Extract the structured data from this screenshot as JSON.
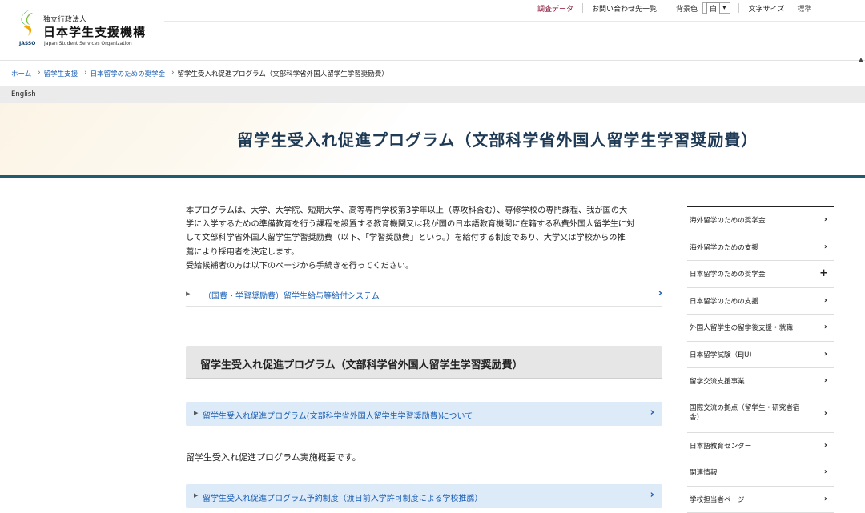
{
  "header": {
    "logo_small": "独立行政法人",
    "logo_big": "日本学生支援機構",
    "logo_jasso": "JASSO",
    "logo_english": "Japan Student Services Organization",
    "util_links": [
      "調査データ",
      "お問い合わせ先一覧"
    ],
    "bg_color_label": "背景色",
    "bg_color_value": "白",
    "bg_color_caret": "▾",
    "font_size_label": "文字サイズ",
    "font_size_value": "標準"
  },
  "breadcrumb": {
    "items": [
      "ホーム",
      "留学生支援",
      "日本留学のための奨学金",
      "留学生受入れ促進プログラム（文部科学省外国人留学生学習奨励費）"
    ],
    "chevron": "›"
  },
  "lang_link": "English",
  "hero": {
    "title": "留学生受入れ促進プログラム（文部科学省外国人留学生学習奨励費）"
  },
  "intro": {
    "lines": [
      "本プログラムは、大学、大学院、短期大学、高等専門学校第3学年以上（専攻科含む）、専修学校の専門課程、我が国の大",
      "学に入学するための準備教育を行う課程を設置する教育機関又は我が国の日本語教育機関に在籍する私費外国人留学生に対",
      "して文部科学省外国人留学生学習奨励費（以下、「学習奨励費」という。）を給付する制度であり、大学又は学校からの推",
      "薦により採用者を決定します。",
      "受給候補者の方は以下のページから手続きを行ってください。"
    ]
  },
  "system_link": {
    "marker": "▶",
    "label": "（国費・学習奨励費）留学生給与等給付システム",
    "arrow": "›"
  },
  "section": {
    "heading": "留学生受入れ促進プログラム（文部科学省外国人留学生学習奨励費）",
    "rows": [
      {
        "marker": "▶",
        "label": "留学生受入れ促進プログラム(文部科学省外国人留学生学習奨励費)について",
        "arrow": "›"
      },
      {
        "marker": "▶",
        "label": "留学生受入れ促進プログラム予約制度（渡日前入学許可制度による学校推薦）",
        "arrow": "›"
      }
    ],
    "overview": "留学生受入れ促進プログラム実施概要です。"
  },
  "sidebar": {
    "items": [
      {
        "label": "海外留学のための奨学金",
        "icon": "›"
      },
      {
        "label": "海外留学のための支援",
        "icon": "›"
      },
      {
        "label": "日本留学のための奨学金",
        "icon": "+"
      },
      {
        "label": "日本留学のための支援",
        "icon": "›"
      },
      {
        "label": "外国人留学生の留学後支援・就職",
        "icon": "›"
      },
      {
        "label": "日本留学試験（EJU）",
        "icon": "›"
      },
      {
        "label": "留学交流支援事業",
        "icon": "›"
      },
      {
        "label": "国際交流の拠点（留学生・研究者宿舎）",
        "icon": "›"
      },
      {
        "label": "日本語教育センター",
        "icon": "›"
      },
      {
        "label": "関連情報",
        "icon": "›"
      },
      {
        "label": "学校担当者ページ",
        "icon": "›"
      }
    ]
  },
  "colors": {
    "link": "#1a5fb4",
    "hero_bar": "#1f5c70",
    "hero_title": "#1e3a55",
    "blue_row": "#ddeaf7",
    "section_bg": "#e6e6e6"
  }
}
